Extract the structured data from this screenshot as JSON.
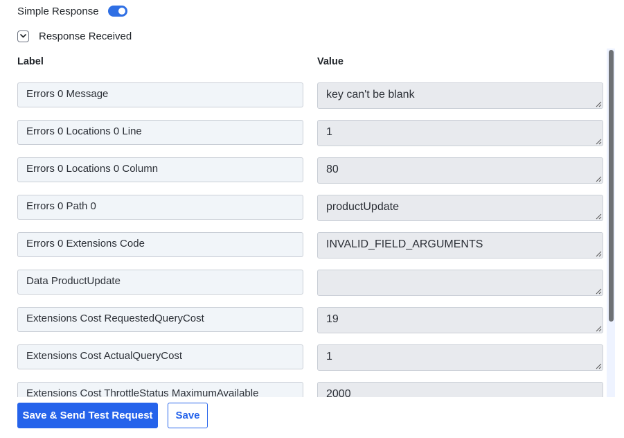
{
  "simple_response": {
    "label": "Simple Response",
    "enabled": true
  },
  "response_received": {
    "label": "Response Received",
    "expanded": true
  },
  "table": {
    "label_header": "Label",
    "value_header": "Value",
    "rows": [
      {
        "label": "Errors 0 Message",
        "value": "key can't be blank"
      },
      {
        "label": "Errors 0 Locations 0 Line",
        "value": "1"
      },
      {
        "label": "Errors 0 Locations 0 Column",
        "value": "80"
      },
      {
        "label": "Errors 0 Path 0",
        "value": "productUpdate"
      },
      {
        "label": "Errors 0 Extensions Code",
        "value": "INVALID_FIELD_ARGUMENTS"
      },
      {
        "label": "Data ProductUpdate",
        "value": ""
      },
      {
        "label": "Extensions Cost RequestedQueryCost",
        "value": "19"
      },
      {
        "label": "Extensions Cost ActualQueryCost",
        "value": "1"
      },
      {
        "label": "Extensions Cost ThrottleStatus MaximumAvailable",
        "value": "2000"
      }
    ]
  },
  "buttons": {
    "save_and_send": "Save & Send Test Request",
    "save": "Save"
  },
  "colors": {
    "accent": "#2563eb",
    "toggle_on": "#2f6fe4"
  }
}
